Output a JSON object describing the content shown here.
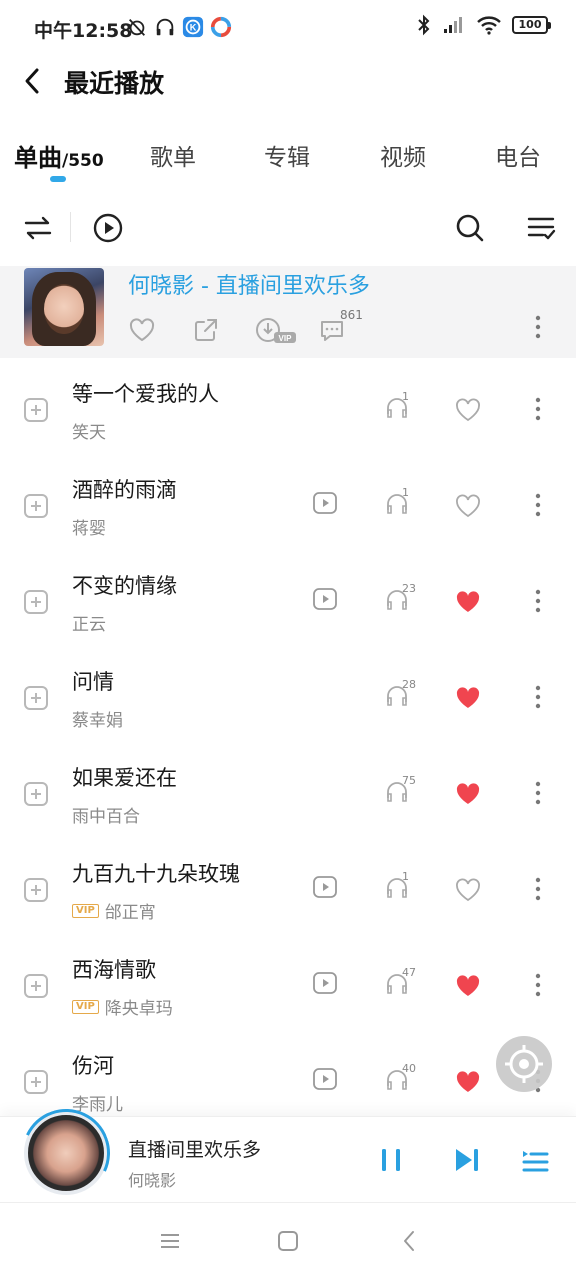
{
  "status": {
    "time": "中午12:58",
    "battery": "100"
  },
  "header": {
    "title": "最近播放"
  },
  "tabs": [
    {
      "label": "单曲",
      "count": "/550",
      "active": true
    },
    {
      "label": "歌单"
    },
    {
      "label": "专辑"
    },
    {
      "label": "视频"
    },
    {
      "label": "电台"
    }
  ],
  "playing": {
    "title": "何晓影 - 直播间里欢乐多",
    "comment_count": "861"
  },
  "songs": [
    {
      "title": "等一个爱我的人",
      "artist": "笑天",
      "vip": false,
      "mv": false,
      "plays": "1",
      "liked": false
    },
    {
      "title": "酒醉的雨滴",
      "artist": "蒋婴",
      "vip": false,
      "mv": true,
      "plays": "1",
      "liked": false
    },
    {
      "title": "不变的情缘",
      "artist": "正云",
      "vip": false,
      "mv": true,
      "plays": "23",
      "liked": true
    },
    {
      "title": "问情",
      "artist": "蔡幸娟",
      "vip": false,
      "mv": false,
      "plays": "28",
      "liked": true
    },
    {
      "title": "如果爱还在",
      "artist": "雨中百合",
      "vip": false,
      "mv": false,
      "plays": "75",
      "liked": true
    },
    {
      "title": "九百九十九朵玫瑰",
      "artist": "邰正宵",
      "vip": true,
      "mv": true,
      "plays": "1",
      "liked": false
    },
    {
      "title": "西海情歌",
      "artist": "降央卓玛",
      "vip": true,
      "mv": true,
      "plays": "47",
      "liked": true
    },
    {
      "title": "伤河",
      "artist": "李雨儿",
      "vip": false,
      "mv": true,
      "plays": "40",
      "liked": true
    }
  ],
  "vip_label": "VIP",
  "mini_player": {
    "title": "直播间里欢乐多",
    "artist": "何晓影"
  },
  "colors": {
    "accent": "#2aa0e0",
    "heart": "#f0454f",
    "vip": "#e5a94a"
  }
}
